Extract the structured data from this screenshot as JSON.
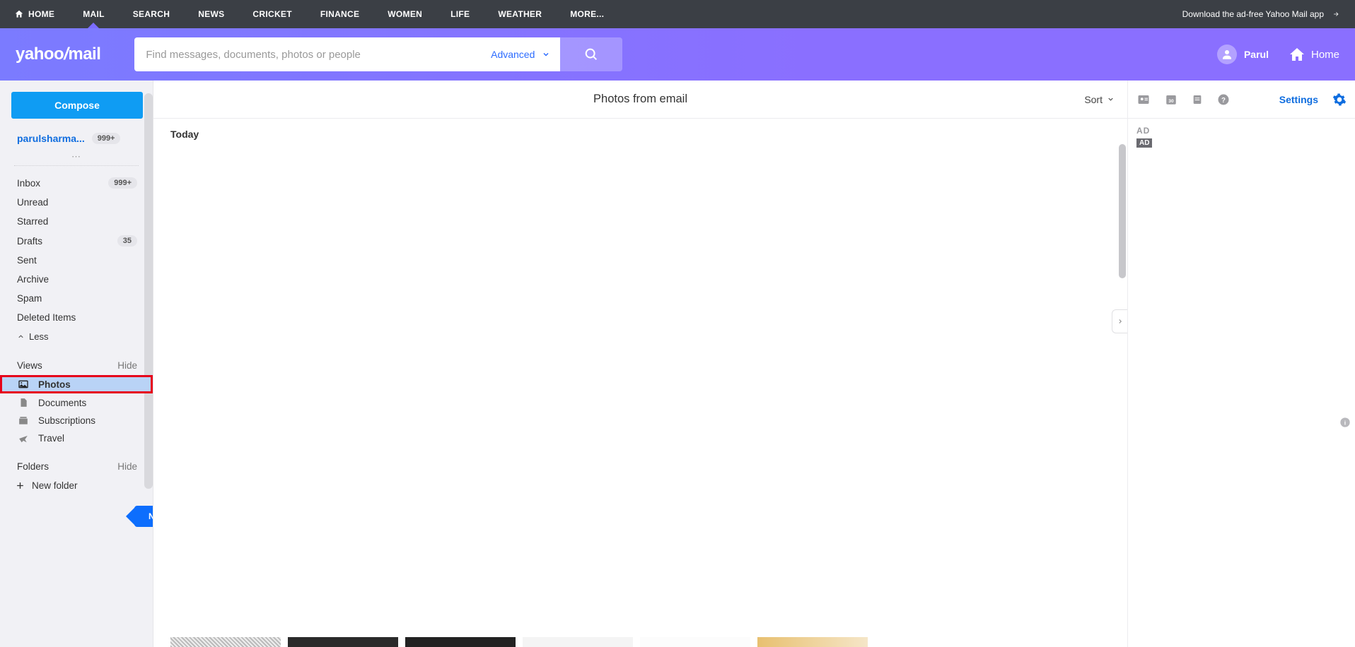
{
  "topnav": {
    "items": [
      "HOME",
      "MAIL",
      "SEARCH",
      "NEWS",
      "CRICKET",
      "FINANCE",
      "WOMEN",
      "LIFE",
      "WEATHER",
      "MORE..."
    ],
    "active_index": 1,
    "download": "Download the ad-free Yahoo Mail app"
  },
  "header": {
    "logo1": "yahoo",
    "logo2": "/",
    "logo3": "mail",
    "search_placeholder": "Find messages, documents, photos or people",
    "advanced": "Advanced",
    "username": "Parul",
    "home": "Home"
  },
  "sidebar": {
    "compose": "Compose",
    "account_name": "parulsharma...",
    "account_badge": "999+",
    "folders": [
      {
        "name": "Inbox",
        "badge": "999+"
      },
      {
        "name": "Unread",
        "badge": ""
      },
      {
        "name": "Starred",
        "badge": ""
      },
      {
        "name": "Drafts",
        "badge": "35"
      },
      {
        "name": "Sent",
        "badge": ""
      },
      {
        "name": "Archive",
        "badge": ""
      },
      {
        "name": "Spam",
        "badge": ""
      },
      {
        "name": "Deleted Items",
        "badge": ""
      }
    ],
    "less": "Less",
    "views_label": "Views",
    "hide": "Hide",
    "views": [
      {
        "name": "Photos",
        "icon": "photo"
      },
      {
        "name": "Documents",
        "icon": "doc"
      },
      {
        "name": "Subscriptions",
        "icon": "sub"
      },
      {
        "name": "Travel",
        "icon": "travel"
      }
    ],
    "new_tag": "New",
    "folders_label": "Folders",
    "new_folder": "New folder"
  },
  "main": {
    "title": "Photos from email",
    "sort": "Sort",
    "today": "Today"
  },
  "right": {
    "settings": "Settings",
    "ad_text": "AD",
    "ad_badge": "AD"
  }
}
